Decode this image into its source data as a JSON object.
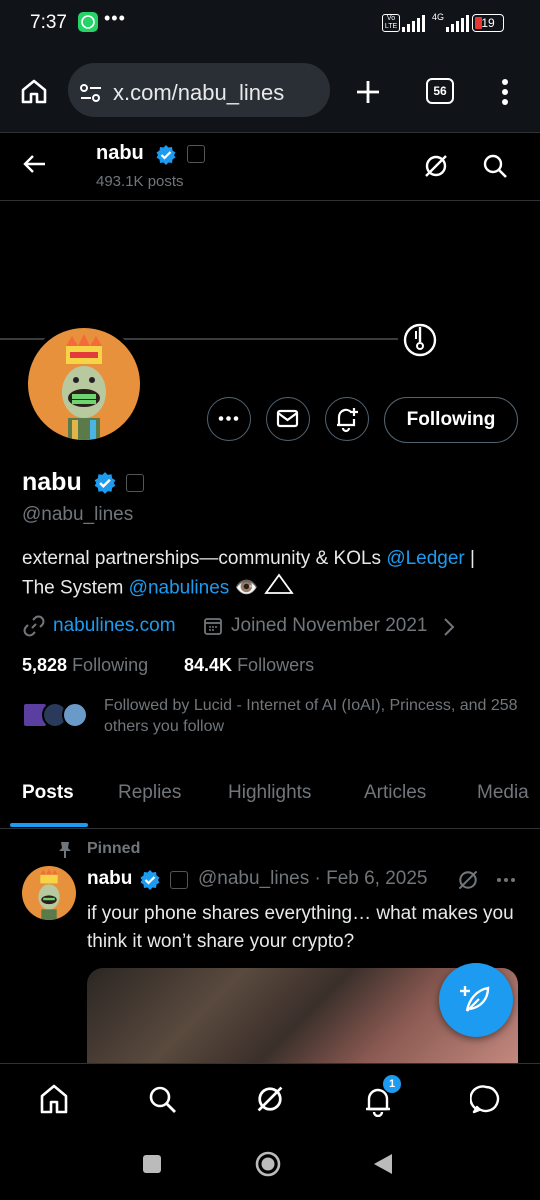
{
  "status_bar": {
    "time": "7:37",
    "network": "4G",
    "volte": "Vo LTE",
    "battery": "19"
  },
  "browser": {
    "url": "x.com/nabu_lines",
    "tab_count": "56"
  },
  "header": {
    "name": "nabu",
    "post_count": "493.1K posts"
  },
  "profile": {
    "display_name": "nabu",
    "handle": "@nabu_lines",
    "bio_part1": "external partnerships—community & KOLs ",
    "bio_mention1": "@Ledger",
    "bio_part2": " |",
    "bio_line2": "The System ",
    "bio_mention2": "@nabulines",
    "bio_emoji": "👁️",
    "website": "nabulines.com",
    "joined": "Joined November 2021",
    "following_count": "5,828",
    "following_label": "Following",
    "followers_count": "84.4K",
    "followers_label": "Followers",
    "followed_by": "Followed by Lucid - Internet of AI (IoAI), Princess, and 258 others you follow",
    "follow_button": "Following"
  },
  "tabs": [
    {
      "label": "Posts"
    },
    {
      "label": "Replies"
    },
    {
      "label": "Highlights"
    },
    {
      "label": "Articles"
    },
    {
      "label": "Media"
    }
  ],
  "post": {
    "pinned_label": "Pinned",
    "author_name": "nabu",
    "author_handle": "@nabu_lines · Feb 6, 2025",
    "text": "if your phone shares everything… what makes you think it won’t share your crypto?"
  },
  "bottom_nav": {
    "notification_badge": "1"
  },
  "colors": {
    "accent": "#1d9bf0",
    "background": "#000000",
    "muted": "#71767b",
    "avatar_bg": "#e8913d"
  },
  "icons": [
    "home-icon",
    "search-icon",
    "grok-icon",
    "notifications-icon",
    "messages-icon",
    "back-arrow-icon",
    "more-icon",
    "mail-icon",
    "bell-plus-icon",
    "link-icon",
    "calendar-icon",
    "pin-icon",
    "compose-icon"
  ]
}
